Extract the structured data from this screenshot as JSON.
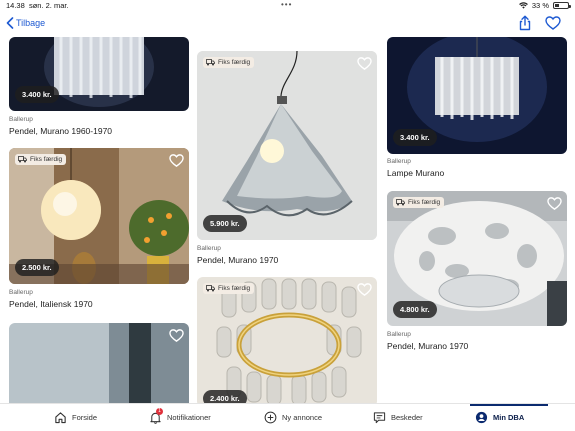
{
  "status": {
    "time": "14.38",
    "date": "søn. 2. mar.",
    "battery": "33 %",
    "battery_level": 0.33
  },
  "nav": {
    "back_label": "Tilbage"
  },
  "badge_label": "Fiks færdig",
  "listings": [
    {
      "price": "3.400 kr.",
      "location": "Ballerup",
      "title": "Pendel, Murano 1960-1970",
      "badge": false
    },
    {
      "price": "5.900 kr.",
      "location": "Ballerup",
      "title": "Pendel, Murano 1970",
      "badge": true
    },
    {
      "price": "3.400 kr.",
      "location": "Ballerup",
      "title": "Lampe Murano",
      "badge": false
    },
    {
      "price": "2.500 kr.",
      "location": "Ballerup",
      "title": "Pendel, Italiensk 1970",
      "badge": true
    },
    {
      "price": "4.800 kr.",
      "location": "Ballerup",
      "title": "Pendel, Murano 1970",
      "badge": true
    },
    {
      "price": "2.400 kr.",
      "location": "",
      "title": "",
      "badge": true
    },
    {
      "price": "",
      "location": "",
      "title": "",
      "badge": false
    }
  ],
  "tabs": [
    {
      "label": "Forside",
      "icon": "home-icon"
    },
    {
      "label": "Notifikationer",
      "icon": "bell-icon",
      "count": "1"
    },
    {
      "label": "Ny annonce",
      "icon": "plus-circle-icon"
    },
    {
      "label": "Beskeder",
      "icon": "chat-icon"
    },
    {
      "label": "Min DBA",
      "icon": "profile-icon"
    }
  ],
  "colors": {
    "accent": "#1e5ad2",
    "active_tab": "#0b2a6f",
    "notification": "#e0303b"
  }
}
